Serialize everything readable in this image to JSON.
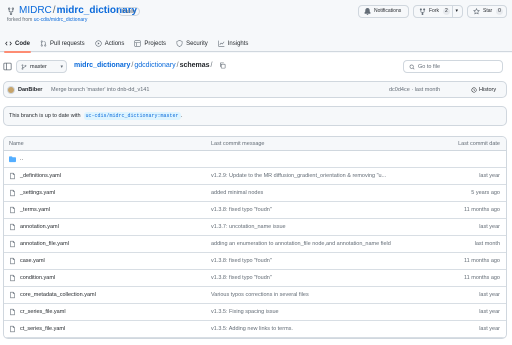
{
  "repo": {
    "owner": "MIDRC",
    "separator": "/",
    "name": "midrc_dictionary",
    "visibility": "Public",
    "forked_prefix": "forked from",
    "forked_from": "uc-cdis/midrc_dictionary"
  },
  "actions": {
    "notifications_label": "Notifications",
    "fork_label": "Fork",
    "fork_count": "2",
    "star_label": "Star",
    "star_count": "0"
  },
  "tabs": [
    {
      "label": "Code",
      "icon": "code-icon"
    },
    {
      "label": "Pull requests",
      "icon": "pull-request-icon"
    },
    {
      "label": "Actions",
      "icon": "play-icon"
    },
    {
      "label": "Projects",
      "icon": "table-icon"
    },
    {
      "label": "Security",
      "icon": "shield-icon"
    },
    {
      "label": "Insights",
      "icon": "graph-icon"
    }
  ],
  "branch": "master",
  "breadcrumb": {
    "root": "midrc_dictionary",
    "mid": "gdcdictionary",
    "current": "schemas",
    "sep": "/"
  },
  "search": {
    "placeholder": "Go to file"
  },
  "commit": {
    "author": "DanBiber",
    "message": "Merge branch 'master' into dnb-dd_v141",
    "hash_time": "dc0d4ce · last month",
    "history_label": "History"
  },
  "uptodate": {
    "text": "This branch is up to date with",
    "ref": "uc-cdis/midrc_dictionary:master",
    "suffix": "."
  },
  "table": {
    "headers": {
      "name": "Name",
      "message": "Last commit message",
      "date": "Last commit date"
    },
    "rows": [
      {
        "name": "..",
        "message": "",
        "date": "",
        "type": "folder"
      },
      {
        "name": "_definitions.yaml",
        "message": "v1.2.9: Update to the MR diffusion_gradient_orientation & removing \"u...",
        "date": "last year",
        "type": "file"
      },
      {
        "name": "_settings.yaml",
        "message": "added minimal nodes",
        "date": "5 years ago",
        "type": "file"
      },
      {
        "name": "_terms.yaml",
        "message": "v1.3.8: fixed typo \"foudn\"",
        "date": "11 months ago",
        "type": "file"
      },
      {
        "name": "annotation.yaml",
        "message": "v1.3.7: uncotation_name issue",
        "date": "last year",
        "type": "file"
      },
      {
        "name": "annotation_file.yaml",
        "message": "adding an enumeration to annotation_file node,and annotation_name field",
        "date": "last month",
        "type": "file"
      },
      {
        "name": "case.yaml",
        "message": "v1.3.8: fixed typo \"foudn\"",
        "date": "11 months ago",
        "type": "file"
      },
      {
        "name": "condition.yaml",
        "message": "v1.3.8: fixed typo \"foudn\"",
        "date": "11 months ago",
        "type": "file"
      },
      {
        "name": "core_metadata_collection.yaml",
        "message": "Various typos corrections in several files",
        "date": "last year",
        "type": "file"
      },
      {
        "name": "cr_series_file.yaml",
        "message": "v1.3.5: Fixing spacing issue",
        "date": "last year",
        "type": "file"
      },
      {
        "name": "ct_series_file.yaml",
        "message": "v1.3.5: Adding new links to terms.",
        "date": "last year",
        "type": "file"
      }
    ]
  },
  "colors": {
    "link": "#0969da",
    "muted": "#636c76",
    "folder": "#54aeff",
    "active_tab": "#fd8c73",
    "border": "#d0d7de"
  }
}
